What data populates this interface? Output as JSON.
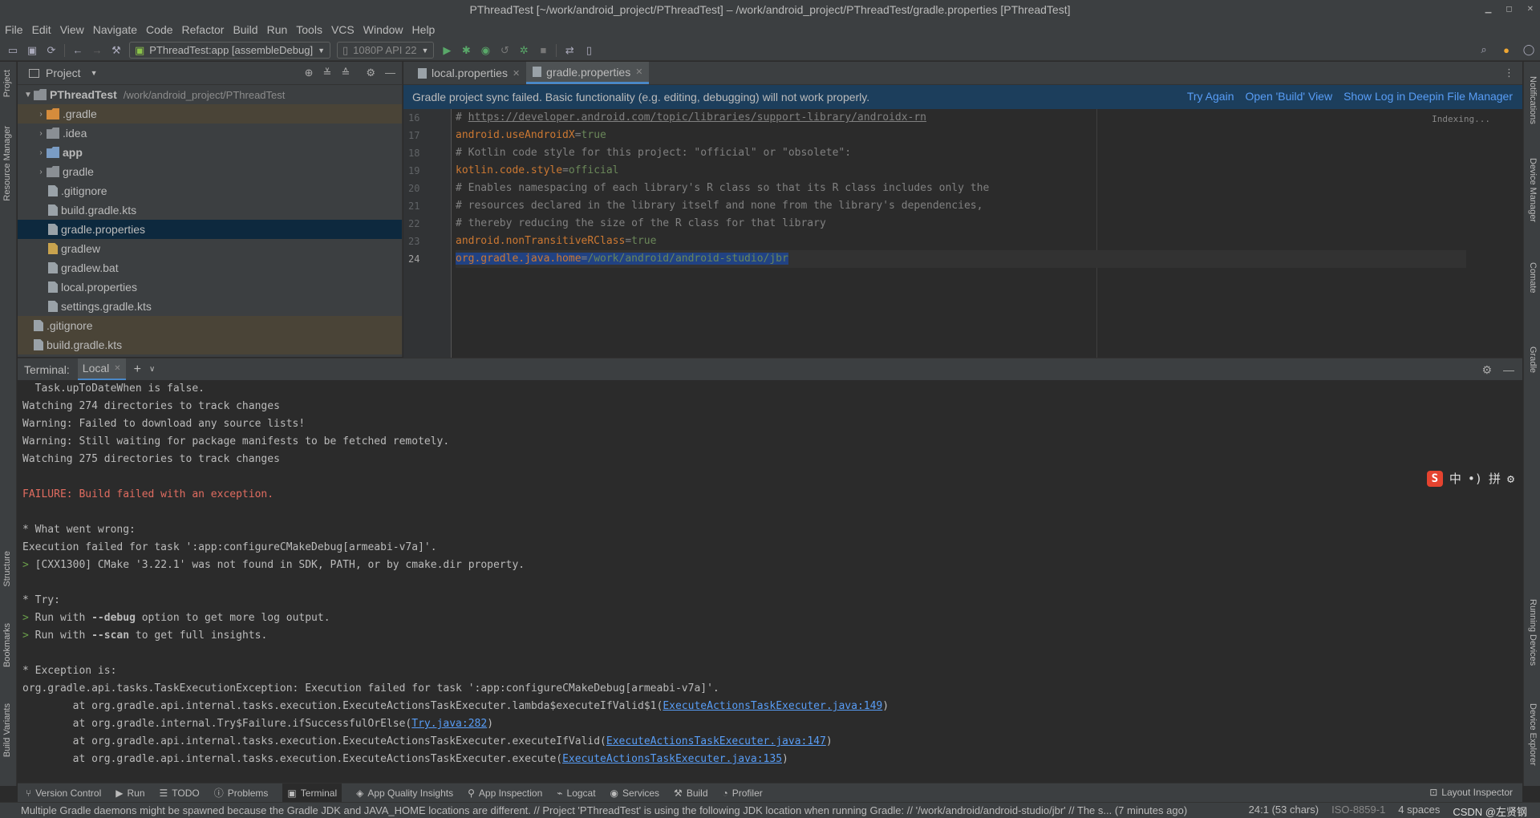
{
  "window": {
    "title": "PThreadTest [~/work/android_project/PThreadTest] – /work/android_project/PThreadTest/gradle.properties [PThreadTest]"
  },
  "menu": [
    "File",
    "Edit",
    "View",
    "Navigate",
    "Code",
    "Refactor",
    "Build",
    "Run",
    "Tools",
    "VCS",
    "Window",
    "Help"
  ],
  "toolbar": {
    "run_config": "PThreadTest:app [assembleDebug]",
    "device": "1080P API 22"
  },
  "project": {
    "header": "Project",
    "root": {
      "name": "PThreadTest",
      "path": "/work/android_project/PThreadTest"
    },
    "items": [
      {
        "label": ".gradle"
      },
      {
        "label": ".idea"
      },
      {
        "label": "app"
      },
      {
        "label": "gradle"
      },
      {
        "label": ".gitignore"
      },
      {
        "label": "build.gradle.kts"
      },
      {
        "label": "gradle.properties"
      },
      {
        "label": "gradlew"
      },
      {
        "label": "gradlew.bat"
      },
      {
        "label": "local.properties"
      },
      {
        "label": "settings.gradle.kts"
      },
      {
        "label": ".gitignore"
      },
      {
        "label": "build.gradle.kts"
      }
    ]
  },
  "editor": {
    "tabs": [
      {
        "label": "local.properties"
      },
      {
        "label": "gradle.properties"
      }
    ],
    "banner": {
      "message": "Gradle project sync failed. Basic functionality (e.g. editing, debugging) will not work properly.",
      "try_again": "Try Again",
      "open_build": "Open 'Build' View",
      "show_log": "Show Log in Deepin File Manager"
    },
    "indexing": "Indexing...",
    "line_numbers": [
      "16",
      "17",
      "18",
      "19",
      "20",
      "21",
      "22",
      "23",
      "24"
    ],
    "lines": [
      {
        "prefix": "# ",
        "url": "https://developer.android.com/topic/libraries/support-library/androidx-rn"
      },
      {
        "key": "android.useAndroidX",
        "val": "true"
      },
      {
        "comment": "# Kotlin code style for this project: \"official\" or \"obsolete\":"
      },
      {
        "key": "kotlin.code.style",
        "val": "official"
      },
      {
        "comment": "# Enables namespacing of each library's R class so that its R class includes only the"
      },
      {
        "comment": "# resources declared in the library itself and none from the library's dependencies,"
      },
      {
        "comment": "# thereby reducing the size of the R class for that library"
      },
      {
        "key": "android.nonTransitiveRClass",
        "val": "true"
      },
      {
        "key": "org.gradle.java.home",
        "val": "/work/android/android-studio/jbr"
      }
    ]
  },
  "terminal": {
    "title": "Terminal:",
    "tab": "Local",
    "ime": {
      "logo": "S",
      "lang": "中",
      "punct": "•)",
      "pinyin": "拼"
    },
    "lines": {
      "l1": "  Task.upToDateWhen is false.",
      "l2": "Watching 274 directories to track changes",
      "l3": "Warning: Failed to download any source lists!",
      "l4": "Warning: Still waiting for package manifests to be fetched remotely.",
      "l5": "Watching 275 directories to track changes",
      "l7": "FAILURE: Build failed with an exception.",
      "l9": "* What went wrong:",
      "l10": "Execution failed for task ':app:configureCMakeDebug[armeabi-v7a]'.",
      "l11": "[CXX1300] CMake '3.22.1' was not found in SDK, PATH, or by cmake.dir property.",
      "l13": "* Try:",
      "l14a": "Run with ",
      "l14b": "--debug",
      "l14c": " option to get more log output.",
      "l15a": "Run with ",
      "l15b": "--scan",
      "l15c": " to get full insights.",
      "l17": "* Exception is:",
      "l18": "org.gradle.api.tasks.TaskExecutionException: Execution failed for task ':app:configureCMakeDebug[armeabi-v7a]'.",
      "l19a": "        at org.gradle.api.internal.tasks.execution.ExecuteActionsTaskExecuter.lambda$executeIfValid$1(",
      "l19b": "ExecuteActionsTaskExecuter.java:149",
      "l20a": "        at org.gradle.internal.Try$Failure.ifSuccessfulOrElse(",
      "l20b": "Try.java:282",
      "l21a": "        at org.gradle.api.internal.tasks.execution.ExecuteActionsTaskExecuter.executeIfValid(",
      "l21b": "ExecuteActionsTaskExecuter.java:147",
      "l22a": "        at org.gradle.api.internal.tasks.execution.ExecuteActionsTaskExecuter.execute(",
      "l22b": "ExecuteActionsTaskExecuter.java:135",
      "close_paren": ")",
      "prompt": "> "
    }
  },
  "bottom_tools": [
    "Version Control",
    "Run",
    "TODO",
    "Problems",
    "Terminal",
    "App Quality Insights",
    "App Inspection",
    "Logcat",
    "Services",
    "Build",
    "Profiler"
  ],
  "bottom_right": "Layout Inspector",
  "left_tools": {
    "project": "Project",
    "resource_manager": "Resource Manager",
    "structure": "Structure",
    "bookmarks": "Bookmarks",
    "build_variants": "Build Variants"
  },
  "right_tools": {
    "notifications": "Notifications",
    "device_manager": "Device Manager",
    "comate": "Comate",
    "gradle": "Gradle",
    "running_devices": "Running Devices",
    "device_explorer": "Device Explorer"
  },
  "status": {
    "message": "Multiple Gradle daemons might be spawned because the Gradle JDK and JAVA_HOME locations are different. // Project 'PThreadTest' is using the following JDK location when running Gradle: // '/work/android/android-studio/jbr' // The s... (7 minutes ago)",
    "position": "24:1 (53 chars)",
    "encoding": "ISO-8859-1",
    "indent": "4 spaces",
    "watermark": "CSDN @左贤钢"
  }
}
